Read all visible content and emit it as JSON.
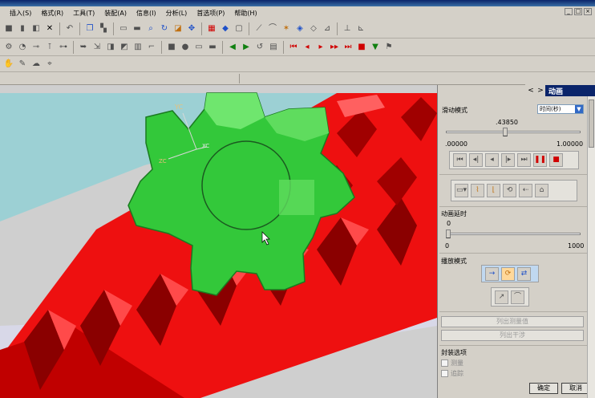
{
  "window": {
    "controls": [
      "_",
      "□",
      "×"
    ]
  },
  "menu": {
    "items": [
      "插入(S)",
      "格式(R)",
      "工具(T)",
      "装配(A)",
      "信息(I)",
      "分析(L)",
      "首选项(P)",
      "帮助(H)"
    ]
  },
  "viewport": {
    "triad_labels": [
      "YC",
      "XC",
      "ZC"
    ],
    "colors": {
      "background_top": "#9cd0d4",
      "background_bottom": "#cfcfcf",
      "gear_green": "#33c83a",
      "gear_green_light": "#6fe66e",
      "rack_red": "#ee1010",
      "rack_dark": "#7a0000"
    }
  },
  "panel": {
    "title": "动画",
    "nav_back": "<",
    "nav_fwd": ">",
    "slide_mode_label": "滑动模式",
    "slide_mode_value": "时间(秒)",
    "slider_value": ".43850",
    "slider_fraction": 0.4385,
    "slider_min": ".00000",
    "slider_max": "1.00000",
    "delay_label": "动画延时",
    "delay_value": "0",
    "delay_min": "0",
    "delay_max": "1000",
    "play_mode_label": "播放模式",
    "list_measure_btn": "列出测量值",
    "list_interference_btn": "列出干涉",
    "pack_options_label": "封装选项",
    "pack_options": [
      "测量",
      "追踪"
    ],
    "ok": "确定",
    "cancel": "取消"
  }
}
